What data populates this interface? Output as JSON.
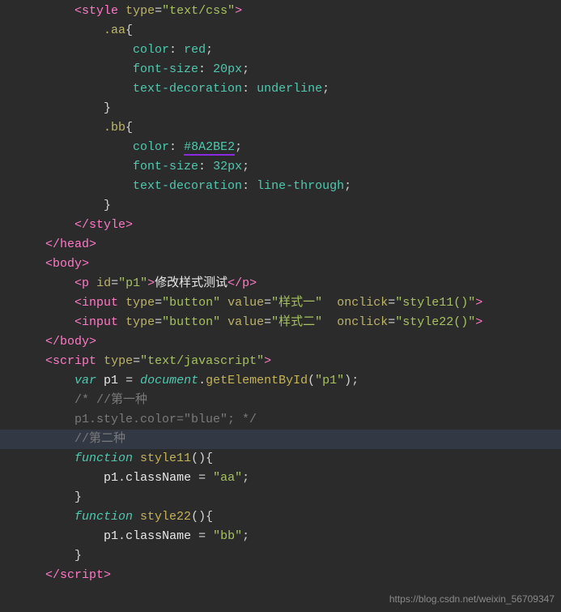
{
  "code": {
    "lines": [
      {
        "indent": "        ",
        "tokens": [
          [
            "<",
            "tag"
          ],
          [
            "style",
            "tagname"
          ],
          [
            " ",
            null
          ],
          [
            "type",
            "attr"
          ],
          [
            "=",
            "equals"
          ],
          [
            "\"text/css\"",
            "strval"
          ],
          [
            ">",
            "tag"
          ]
        ]
      },
      {
        "indent": "            ",
        "tokens": [
          [
            ".aa",
            "selector"
          ],
          [
            "{",
            "brace"
          ]
        ]
      },
      {
        "indent": "                ",
        "tokens": [
          [
            "color",
            "prop"
          ],
          [
            ": ",
            null
          ],
          [
            "red",
            "val-red"
          ],
          [
            ";",
            "semi"
          ]
        ]
      },
      {
        "indent": "                ",
        "tokens": [
          [
            "font-size",
            "prop"
          ],
          [
            ": ",
            null
          ],
          [
            "20px",
            "val-num"
          ],
          [
            ";",
            "semi"
          ]
        ]
      },
      {
        "indent": "                ",
        "tokens": [
          [
            "text-decoration",
            "prop"
          ],
          [
            ": ",
            null
          ],
          [
            "underline",
            "val-kw"
          ],
          [
            ";",
            "semi"
          ]
        ]
      },
      {
        "indent": "            ",
        "tokens": [
          [
            "}",
            "brace"
          ]
        ]
      },
      {
        "indent": "            ",
        "tokens": [
          [
            ".bb",
            "selector"
          ],
          [
            "{",
            "brace"
          ]
        ]
      },
      {
        "indent": "                ",
        "tokens": [
          [
            "color",
            "prop"
          ],
          [
            ": ",
            null
          ],
          [
            "#8A2BE2",
            "hex hex-underline"
          ],
          [
            ";",
            "semi"
          ]
        ]
      },
      {
        "indent": "                ",
        "tokens": [
          [
            "font-size",
            "prop"
          ],
          [
            ": ",
            null
          ],
          [
            "32px",
            "val-num"
          ],
          [
            ";",
            "semi"
          ]
        ]
      },
      {
        "indent": "                ",
        "tokens": [
          [
            "text-decoration",
            "prop"
          ],
          [
            ": ",
            null
          ],
          [
            "line-through",
            "val-kw"
          ],
          [
            ";",
            "semi"
          ]
        ]
      },
      {
        "indent": "            ",
        "tokens": [
          [
            "}",
            "brace"
          ]
        ]
      },
      {
        "indent": "        ",
        "tokens": [
          [
            "</",
            "tag"
          ],
          [
            "style",
            "tagname"
          ],
          [
            ">",
            "tag"
          ]
        ]
      },
      {
        "indent": "    ",
        "tokens": [
          [
            "</",
            "tag"
          ],
          [
            "head",
            "tagname"
          ],
          [
            ">",
            "tag"
          ]
        ]
      },
      {
        "indent": "    ",
        "tokens": [
          [
            "<",
            "tag"
          ],
          [
            "body",
            "tagname"
          ],
          [
            ">",
            "tag"
          ]
        ]
      },
      {
        "indent": "        ",
        "tokens": [
          [
            "<",
            "tag"
          ],
          [
            "p",
            "tagname"
          ],
          [
            " ",
            null
          ],
          [
            "id",
            "attr"
          ],
          [
            "=",
            "equals"
          ],
          [
            "\"p1\"",
            "strval"
          ],
          [
            ">",
            "tag"
          ],
          [
            "修改样式测试",
            "text"
          ],
          [
            "</",
            "tag"
          ],
          [
            "p",
            "tagname"
          ],
          [
            ">",
            "tag"
          ]
        ]
      },
      {
        "indent": "        ",
        "tokens": [
          [
            "<",
            "tag"
          ],
          [
            "input",
            "tagname"
          ],
          [
            " ",
            null
          ],
          [
            "type",
            "attr"
          ],
          [
            "=",
            "equals"
          ],
          [
            "\"button\"",
            "strval"
          ],
          [
            " ",
            null
          ],
          [
            "value",
            "attr"
          ],
          [
            "=",
            "equals"
          ],
          [
            "\"样式一\"",
            "strval"
          ],
          [
            "  ",
            null
          ],
          [
            "onclick",
            "attr"
          ],
          [
            "=",
            "equals"
          ],
          [
            "\"style11()\"",
            "strval"
          ],
          [
            ">",
            "tag"
          ]
        ]
      },
      {
        "indent": "        ",
        "tokens": [
          [
            "<",
            "tag"
          ],
          [
            "input",
            "tagname"
          ],
          [
            " ",
            null
          ],
          [
            "type",
            "attr"
          ],
          [
            "=",
            "equals"
          ],
          [
            "\"button\"",
            "strval"
          ],
          [
            " ",
            null
          ],
          [
            "value",
            "attr"
          ],
          [
            "=",
            "equals"
          ],
          [
            "\"样式二\"",
            "strval"
          ],
          [
            "  ",
            null
          ],
          [
            "onclick",
            "attr"
          ],
          [
            "=",
            "equals"
          ],
          [
            "\"style22()\"",
            "strval"
          ],
          [
            ">",
            "tag"
          ]
        ]
      },
      {
        "indent": "    ",
        "tokens": [
          [
            "</",
            "tag"
          ],
          [
            "body",
            "tagname"
          ],
          [
            ">",
            "tag"
          ]
        ]
      },
      {
        "indent": "    ",
        "tokens": [
          [
            "<",
            "tag"
          ],
          [
            "script",
            "tagname"
          ],
          [
            " ",
            null
          ],
          [
            "type",
            "attr"
          ],
          [
            "=",
            "equals"
          ],
          [
            "\"text/javascript\"",
            "strval"
          ],
          [
            ">",
            "tag"
          ]
        ]
      },
      {
        "indent": "        ",
        "tokens": [
          [
            "var",
            "kw"
          ],
          [
            " ",
            null
          ],
          [
            "p1",
            "ident"
          ],
          [
            " = ",
            null
          ],
          [
            "document",
            "obj"
          ],
          [
            ".",
            null
          ],
          [
            "getElementById",
            "method"
          ],
          [
            "(",
            "paren"
          ],
          [
            "\"p1\"",
            "strval"
          ],
          [
            ")",
            "paren"
          ],
          [
            ";",
            "semi"
          ]
        ]
      },
      {
        "indent": "        ",
        "tokens": [
          [
            "/* //第一种",
            "comment"
          ]
        ]
      },
      {
        "indent": "        ",
        "tokens": [
          [
            "p1.style.color=\"blue\"; */",
            "comment"
          ]
        ]
      },
      {
        "indent": "        ",
        "tokens": [
          [
            "//第二种",
            "comment"
          ]
        ],
        "highlighted": true
      },
      {
        "indent": "        ",
        "tokens": [
          [
            "function",
            "kw-func"
          ],
          [
            " ",
            null
          ],
          [
            "style11",
            "method"
          ],
          [
            "()",
            "paren"
          ],
          [
            "{",
            "brace"
          ]
        ]
      },
      {
        "indent": "            ",
        "tokens": [
          [
            "p1",
            "ident"
          ],
          [
            ".",
            null
          ],
          [
            "className",
            "ident"
          ],
          [
            " = ",
            null
          ],
          [
            "\"aa\"",
            "strval"
          ],
          [
            ";",
            "semi"
          ]
        ]
      },
      {
        "indent": "        ",
        "tokens": [
          [
            "}",
            "brace"
          ]
        ]
      },
      {
        "indent": "        ",
        "tokens": [
          [
            "function",
            "kw-func"
          ],
          [
            " ",
            null
          ],
          [
            "style22",
            "method"
          ],
          [
            "()",
            "paren"
          ],
          [
            "{",
            "brace"
          ]
        ]
      },
      {
        "indent": "            ",
        "tokens": [
          [
            "p1",
            "ident"
          ],
          [
            ".",
            null
          ],
          [
            "className",
            "ident"
          ],
          [
            " = ",
            null
          ],
          [
            "\"bb\"",
            "strval"
          ],
          [
            ";",
            "semi"
          ]
        ]
      },
      {
        "indent": "        ",
        "tokens": [
          [
            "}",
            "brace"
          ]
        ]
      },
      {
        "indent": "    ",
        "tokens": [
          [
            "</",
            "tag"
          ],
          [
            "script",
            "tagname"
          ],
          [
            ">",
            "tag"
          ]
        ]
      }
    ]
  },
  "watermark": "https://blog.csdn.net/weixin_56709347"
}
